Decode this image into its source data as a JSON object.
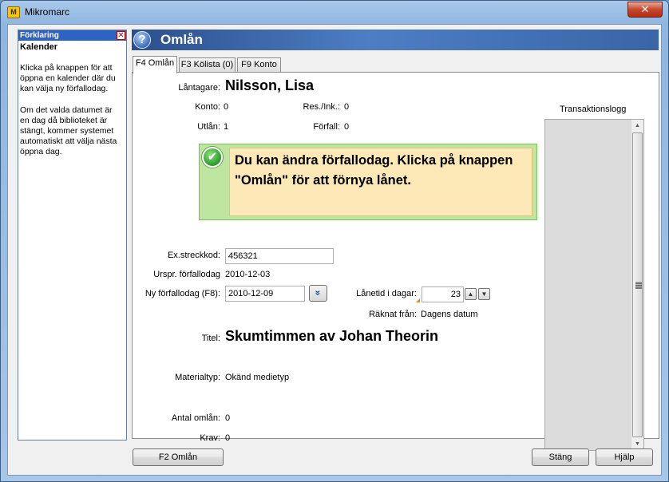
{
  "window": {
    "title": "Mikromarc",
    "icon_label": "M",
    "close_glyph": "✕"
  },
  "help": {
    "header": "Förklaring",
    "close_glyph": "✕",
    "title": "Kalender",
    "paragraphs": [
      "Klicka på knappen för att öppna en kalender där du kan välja ny förfallodag.",
      "Om det valda datumet är en dag då biblioteket är stängt, kommer systemet automatiskt att välja nästa öppna dag."
    ]
  },
  "main": {
    "title": "Omlån",
    "help_glyph": "?"
  },
  "tabs": [
    {
      "label": "F4 Omlån",
      "active": true
    },
    {
      "label": "F3 Kölista (0)",
      "active": false
    },
    {
      "label": "F9 Konto",
      "active": false
    }
  ],
  "borrower": {
    "label": "Låntagare:",
    "name": "Nilsson, Lisa",
    "account_label": "Konto:",
    "account": "0",
    "reservations_label": "Res./Ink.:",
    "reservations": "0",
    "loans_label": "Utlån:",
    "loans": "1",
    "overdue_label": "Förfall:",
    "overdue": "0"
  },
  "message": {
    "text": "Du kan ändra förfallodag. Klicka på knappen \"Omlån\" för att förnya lånet.",
    "check_glyph": "✔"
  },
  "loan": {
    "barcode_label": "Ex.streckkod:",
    "barcode": "456321",
    "orig_due_label": "Urspr. förfallodag",
    "orig_due": "2010-12-03",
    "new_due_label": "Ny förfallodag (F8):",
    "new_due": "2010-12-09",
    "calendar_glyph": "»",
    "days_label": "Lånetid i dagar:",
    "days": "23",
    "counted_from_label": "Räknat från:",
    "counted_from": "Dagens datum"
  },
  "item": {
    "title_label": "Titel:",
    "title": "Skumtimmen av Johan Theorin",
    "material_label": "Materialtyp:",
    "material": "Okänd medietyp",
    "renewals_label": "Antal omlån:",
    "renewals": "0",
    "claims_label": "Krav:",
    "claims": "0"
  },
  "log": {
    "title": "Transaktionslogg"
  },
  "buttons": {
    "renew": "F2 Omlån",
    "close": "Stäng",
    "help": "Hjälp"
  }
}
